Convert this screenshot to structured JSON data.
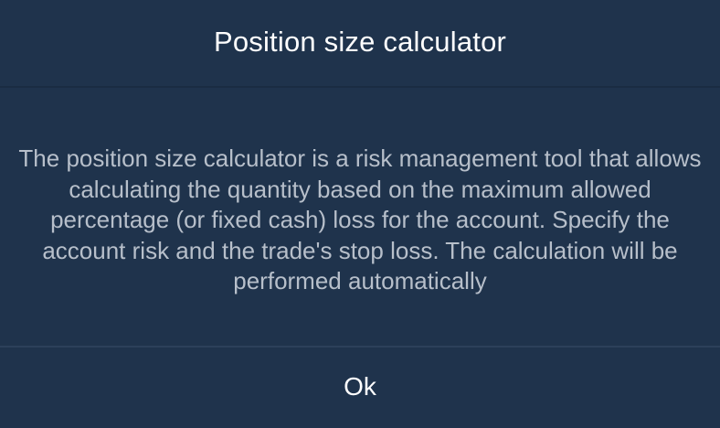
{
  "dialog": {
    "title": "Position size calculator",
    "message": "The position size calculator is a risk management tool that allows calculating the quantity based on the maximum allowed percentage (or fixed cash) loss for the account. Specify the account risk and the trade's stop loss. The calculation will be performed automatically",
    "ok_label": "Ok"
  },
  "colors": {
    "background": "#1f334c",
    "title_text": "#ffffff",
    "message_text": "#b7bfca",
    "divider": "#2c405a"
  }
}
